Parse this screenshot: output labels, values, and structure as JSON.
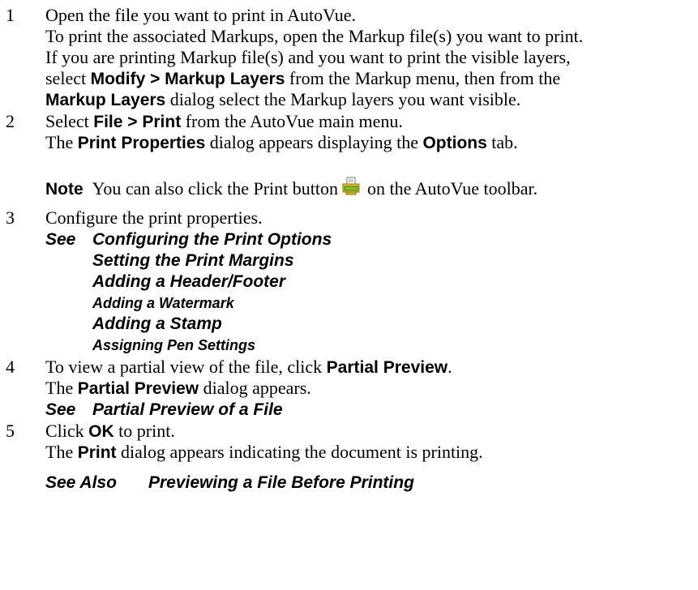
{
  "steps": [
    {
      "number": "1",
      "lines": [
        "Open the file you want to print in AutoVue.",
        "To print the associated Markups, open the Markup file(s) you want to print.",
        "If you are printing Markup file(s) and you want to print the visible layers,"
      ],
      "line4": {
        "pre": "select ",
        "bold": "Modify > Markup Layers",
        "post": " from the Markup menu, then from the"
      },
      "line5": {
        "bold": "Markup Layers",
        "post": " dialog select the Markup layers you want visible."
      }
    },
    {
      "number": "2",
      "line1": {
        "pre": "Select ",
        "bold": "File > Print",
        "post": " from the AutoVue main menu."
      },
      "line2": {
        "pre": "The ",
        "bold1": "Print Properties",
        "mid": " dialog appears displaying the ",
        "bold2": "Options",
        "post": " tab."
      },
      "note": {
        "label": "Note",
        "pre": "You can also click the Print button",
        "post": "on the AutoVue toolbar.",
        "icon": "print-icon"
      }
    },
    {
      "number": "3",
      "text": "Configure the print properties.",
      "see_label": "See",
      "links": [
        "Configuring the Print Options",
        "Setting the Print Margins",
        "Adding a Header/Footer",
        "Adding a Watermark",
        "Adding a Stamp",
        "Assigning Pen Settings"
      ]
    },
    {
      "number": "4",
      "line1": {
        "pre": "To view a partial view of the file, click ",
        "bold": "Partial Preview",
        "post": "."
      },
      "line2": {
        "pre": "The ",
        "bold": "Partial Preview",
        "post": " dialog appears."
      },
      "see_label": "See",
      "see_link": "Partial Preview of a File"
    },
    {
      "number": "5",
      "line1": {
        "pre": "Click ",
        "bold": "OK",
        "post": " to print."
      },
      "line2": {
        "pre": "The ",
        "bold": "Print",
        "post": " dialog appears indicating the document is printing."
      }
    }
  ],
  "see_also": {
    "label": "See Also",
    "link": "Previewing a File Before Printing"
  }
}
